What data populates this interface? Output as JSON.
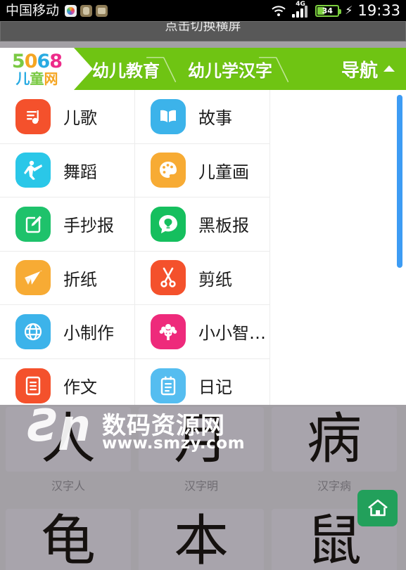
{
  "statusbar": {
    "carrier": "中国移动",
    "app_icons": [
      "photos-icon",
      "contact-icon",
      "gallery-icon"
    ],
    "wifi": "wifi-icon",
    "network_type": "4G",
    "signal": "signal-bars-icon",
    "battery_percent": "34",
    "charging": "⚡",
    "clock": "19:33"
  },
  "rotate_hint": {
    "text": "点击切换横屏"
  },
  "navbar": {
    "logo": {
      "digits": [
        "5",
        "0",
        "6",
        "8"
      ],
      "digit_colors": [
        "#7ac943",
        "#f5a623",
        "#29abe2",
        "#ed2b8a"
      ],
      "subtitle": [
        "儿",
        "童",
        "网"
      ],
      "subtitle_colors": [
        "#29abe2",
        "#7ac943",
        "#f5a623",
        "#ed2b8a"
      ]
    },
    "items": [
      {
        "label": "幼儿教育"
      },
      {
        "label": "幼儿学汉字"
      }
    ],
    "toggle": {
      "label": "导航",
      "icon": "chevron-up-icon"
    },
    "background_color": "#6fc413"
  },
  "menu": {
    "rows": [
      [
        {
          "label": "儿歌",
          "icon": "music-note-icon",
          "color": "#f4512c"
        },
        {
          "label": "故事",
          "icon": "open-book-icon",
          "color": "#3cb3ea"
        }
      ],
      [
        {
          "label": "舞蹈",
          "icon": "dancer-icon",
          "color": "#2ac7e8"
        },
        {
          "label": "儿童画",
          "icon": "palette-icon",
          "color": "#f7ab34"
        }
      ],
      [
        {
          "label": "手抄报",
          "icon": "pencil-edit-icon",
          "color": "#1ec26b"
        },
        {
          "label": "黑板报",
          "icon": "chalkboard-icon",
          "color": "#15bf5e"
        }
      ],
      [
        {
          "label": "折纸",
          "icon": "paper-crane-icon",
          "color": "#f7ab34"
        },
        {
          "label": "剪纸",
          "icon": "scissors-icon",
          "color": "#f4512c"
        }
      ],
      [
        {
          "label": "小制作",
          "icon": "globe-icon",
          "color": "#3cb3ea"
        },
        {
          "label": "小小智…",
          "icon": "tree-icon",
          "color": "#ee2a7b"
        }
      ],
      [
        {
          "label": "作文",
          "icon": "document-icon",
          "color": "#f4512c"
        },
        {
          "label": "日记",
          "icon": "notepad-icon",
          "color": "#55bdf0"
        }
      ]
    ],
    "scrollbar": {
      "name": "vertical-scrollbar",
      "color": "#3d9cf4"
    }
  },
  "background_thumbs": {
    "row1": [
      {
        "glyph": "人",
        "caption": "汉字人"
      },
      {
        "glyph": "月",
        "caption": "汉字明"
      },
      {
        "glyph": "病",
        "caption": "汉字病"
      }
    ],
    "row2": [
      {
        "glyph": "龟",
        "caption": ""
      },
      {
        "glyph": "本",
        "caption": ""
      },
      {
        "glyph": "鼠",
        "caption": ""
      }
    ]
  },
  "watermark": {
    "logo": "Ƨր",
    "site_name": "数码资源网",
    "url": "www.smzy.com"
  },
  "home_button": {
    "name": "home-icon",
    "color": "#22a05b"
  }
}
